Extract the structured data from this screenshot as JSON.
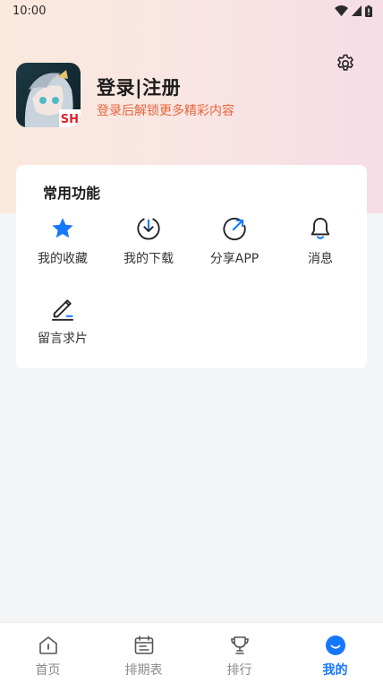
{
  "status_bar": {
    "time": "10:00",
    "icons": [
      "wifi-icon",
      "cellular-signal-icon",
      "battery-icon"
    ]
  },
  "profile": {
    "avatar_badge": "SH",
    "login_label": "登录|注册",
    "subtitle": "登录后解锁更多精彩内容",
    "settings_icon": "gear-icon"
  },
  "functions": {
    "title": "常用功能",
    "items": [
      {
        "label": "我的收藏",
        "icon": "star-icon"
      },
      {
        "label": "我的下载",
        "icon": "download-icon"
      },
      {
        "label": "分享APP",
        "icon": "share-icon"
      },
      {
        "label": "消息",
        "icon": "bell-icon"
      },
      {
        "label": "留言求片",
        "icon": "pen-icon"
      }
    ]
  },
  "tabbar": {
    "items": [
      {
        "label": "首页",
        "icon": "home-icon",
        "active": false
      },
      {
        "label": "排期表",
        "icon": "calendar-icon",
        "active": false
      },
      {
        "label": "排行",
        "icon": "trophy-icon",
        "active": false
      },
      {
        "label": "我的",
        "icon": "smile-icon",
        "active": true
      }
    ]
  },
  "colors": {
    "accent": "#1677ff",
    "subtitle": "#e8663a",
    "header_gradient_start": "#fbe9dd",
    "header_gradient_end": "#f6dde6",
    "page_background": "#f4f5f7"
  }
}
